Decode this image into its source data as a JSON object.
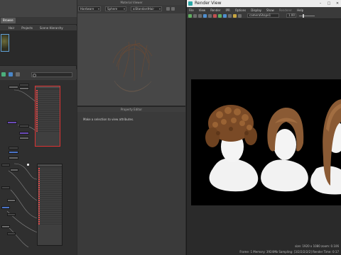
{
  "hypershade": {
    "tabs": [
      "Browse",
      "Materials",
      "Textures",
      "Utilities",
      "Rendering",
      "Lights",
      "Cameras",
      "Shading Groups"
    ],
    "active_tab": "Browse",
    "sub_tabs": [
      "Hair",
      "Projects",
      "Scene Hierarchy"
    ],
    "search_placeholder": "Search..."
  },
  "material_viewer": {
    "title": "Material Viewer",
    "renderer": "Hardware",
    "shape": "Sphere",
    "material": "aiStandardHair"
  },
  "property_editor": {
    "title": "Property Editor",
    "message": "Make a selection to view attributes."
  },
  "render_view": {
    "title": "Render View",
    "menu": [
      "File",
      "View",
      "Render",
      "IPR",
      "Options",
      "Display",
      "Show",
      "Renderer",
      "Help"
    ],
    "camera": "cameraShape1",
    "zoom": "1.00",
    "status_line1": "size: 1920 x 1080 zoom: 0.106",
    "status_line2": "Frame: 1   Memory: 3924Mb   Sampling: [3/2/2/2/2/2]   Render Time: 0:17"
  },
  "colors": {
    "accent_teal": "#2aa7a7",
    "selection_red": "#d33333",
    "node_purple": "#6b4bb8"
  }
}
